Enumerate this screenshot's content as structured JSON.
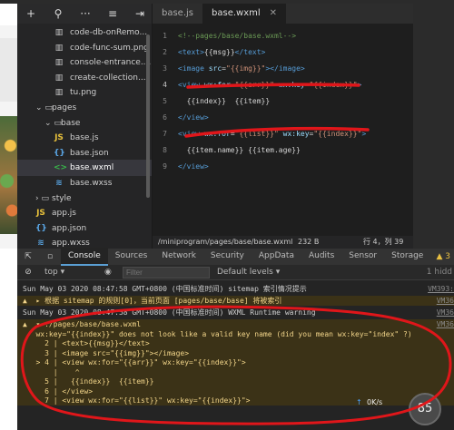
{
  "explorer": {
    "toolbar": [
      "+",
      "search",
      "more",
      "collapse",
      "split"
    ],
    "items": [
      {
        "label": "code-db-onRemo...",
        "icon": "file",
        "indent": 2
      },
      {
        "label": "code-func-sum.png",
        "icon": "file",
        "indent": 2
      },
      {
        "label": "console-entrance....",
        "icon": "file",
        "indent": 2
      },
      {
        "label": "create-collection....",
        "icon": "file",
        "indent": 2
      },
      {
        "label": "tu.png",
        "icon": "file",
        "indent": 2
      },
      {
        "label": "pages",
        "icon": "folder-open",
        "indent": 0
      },
      {
        "label": "base",
        "icon": "folder-open",
        "indent": 1
      },
      {
        "label": "base.js",
        "icon": "js",
        "indent": 2
      },
      {
        "label": "base.json",
        "icon": "json",
        "indent": 2
      },
      {
        "label": "base.wxml",
        "icon": "wxml",
        "indent": 2,
        "selected": true
      },
      {
        "label": "base.wxss",
        "icon": "wxss",
        "indent": 2
      },
      {
        "label": "style",
        "icon": "folder",
        "indent": 0
      },
      {
        "label": "app.js",
        "icon": "js",
        "indent": 0
      },
      {
        "label": "app.json",
        "icon": "json",
        "indent": 0
      },
      {
        "label": "app.wxss",
        "icon": "wxss",
        "indent": 0
      }
    ]
  },
  "editor": {
    "tabs": [
      {
        "label": "base.js",
        "active": false
      },
      {
        "label": "base.wxml",
        "active": true
      }
    ],
    "lines": [
      {
        "n": "1",
        "code": "<!--pages/base/base.wxml-->"
      },
      {
        "n": "2",
        "code": "<text>{{msg}}</text>"
      },
      {
        "n": "3",
        "code": "<image src=\"{{img}}\"></image>"
      },
      {
        "n": "4",
        "code": "<view wx:for=\"{{arr}}\" wx:key=\"{{index}}\">"
      },
      {
        "n": "5",
        "code": "  {{index}}  {{item}}"
      },
      {
        "n": "6",
        "code": "</view>"
      },
      {
        "n": "7",
        "code": "<view wx:for=\"{{list}}\" wx:key=\"{{index}}\">"
      },
      {
        "n": "8",
        "code": "  {{item.name}} {{item.age}}"
      },
      {
        "n": "9",
        "code": "</view>"
      }
    ]
  },
  "status": {
    "path": "/miniprogram/pages/base/base.wxml",
    "size": "232 B",
    "position": "行 4，列 39"
  },
  "devtools": {
    "tabs": [
      "Console",
      "Sources",
      "Network",
      "Security",
      "AppData",
      "Audits",
      "Sensor",
      "Storage"
    ],
    "active_tab": "Console",
    "warn_count": "3",
    "context": "top",
    "filter_placeholder": "Filter",
    "levels": "Default levels",
    "hidden": "1 hidd",
    "messages": [
      {
        "text": "Sun May 03 2020 08:47:58 GMT+0800 (中国标准时间) sitemap 索引情况提示",
        "src": "VM393:",
        "kind": "info"
      },
      {
        "text": "▲  ▸ 根据 sitemap 的规则[0]，当前页面 [pages/base/base] 将被索引",
        "src": "VM36",
        "kind": "warn"
      },
      {
        "text": "Sun May 03 2020 08:47:58 GMT+0800 (中国标准时间) WXML Runtime warning",
        "src": "VM36",
        "kind": "info"
      },
      {
        "text": "▲  ▾ ./pages/base/base.wxml",
        "src": "VM36",
        "kind": "warn"
      },
      {
        "text": "   wx:key=\"{{index}}\" does not look like a valid key name (did you mean wx:key=\"index\" ?)",
        "src": "",
        "kind": "warn"
      },
      {
        "text": "     2 | <text>{{msg}}</text>",
        "src": "",
        "kind": "warn"
      },
      {
        "text": "     3 | <image src=\"{{img}}\"></image>",
        "src": "",
        "kind": "warn"
      },
      {
        "text": "   > 4 | <view wx:for=\"{{arr}}\" wx:key=\"{{index}}\">",
        "src": "",
        "kind": "warn"
      },
      {
        "text": "       |    ^",
        "src": "",
        "kind": "warn"
      },
      {
        "text": "     5 |   {{index}}  {{item}}",
        "src": "",
        "kind": "warn"
      },
      {
        "text": "     6 | </view>",
        "src": "",
        "kind": "warn"
      },
      {
        "text": "     7 | <view wx:for=\"{{list}}\" wx:key=\"{{index}}\">",
        "src": "",
        "kind": "warn"
      }
    ]
  },
  "speed": "0K/s",
  "circle": "85",
  "colors": {
    "annotation": "#e0161a",
    "editor_bg": "#1e1e1e",
    "warning_bg": "#3b3217"
  }
}
